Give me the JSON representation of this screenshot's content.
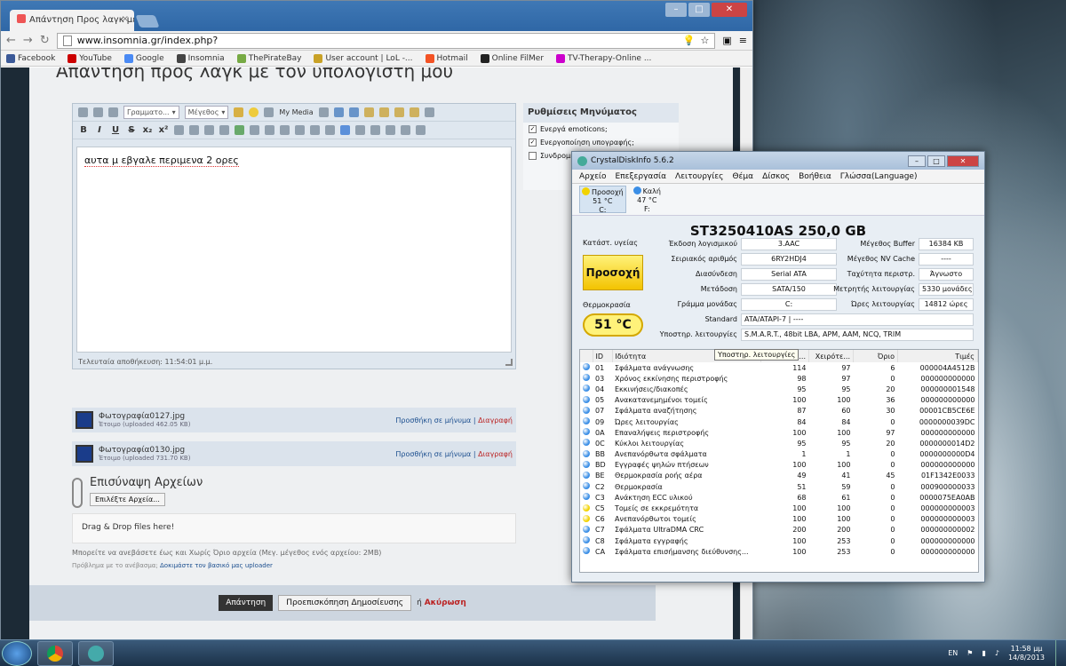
{
  "browser": {
    "tab_title": "Απάντηση Προς λαγκ με...",
    "url": "www.insomnia.gr/index.php?",
    "bookmarks": [
      "Facebook",
      "YouTube",
      "Google",
      "Insomnia",
      "ThePirateBay",
      "User account | LoL -...",
      "Hotmail",
      "Online FilMer",
      "TV-Therapy-Online ..."
    ],
    "bookmark_colors": [
      "#3b5998",
      "#cc0000",
      "#4a8af4",
      "#444444",
      "#7a4",
      "#c9a227",
      "#f35325",
      "#222222",
      "#c0c"
    ]
  },
  "page": {
    "heading": "Απάντηση προς λαγκ με τον υπολογιστή μου",
    "editor": {
      "font_select": "Γραμματο...",
      "size_select": "Μέγεθος",
      "my_media": "My Media",
      "text": "αυτα μ εβγαλε περιμενα 2 ορες",
      "autosave": "Τελευταία αποθήκευση: 11:54:01 μ.μ."
    },
    "sidebar": {
      "title": "Ρυθμίσεις Μηνύματος",
      "options": [
        {
          "label": "Ενεργά emoticons;",
          "checked": "✓"
        },
        {
          "label": "Ενεργοποίηση υπογραφής;",
          "checked": "✓"
        },
        {
          "label": "Συνδρομή",
          "checked": ""
        }
      ]
    },
    "attachments": [
      {
        "name": "Φωτογραφία0127.jpg",
        "status": "Έτοιμο (uploaded 462.05 KB)"
      },
      {
        "name": "Φωτογραφία0130.jpg",
        "status": "Έτοιμο (uploaded 731.70 KB)"
      }
    ],
    "attach_actions": {
      "insert": "Προσθήκη σε μήνυμα",
      "sep": " | ",
      "delete": "Διαγραφή"
    },
    "upload": {
      "title": "Επισύναψη Αρχείων",
      "choose": "Επιλέξτε Αρχεία...",
      "dnd": "Drag & Drop files here!",
      "note": "Μπορείτε να ανεβάσετε έως και Χωρίς Όριο αρχεία (Μεγ. μέγεθος ενός αρχείου: 2MB)",
      "note2_a": "Πρόβλημα με το ανέβασμα;",
      "note2_b": "Δοκιμάστε τον βασικό μας uploader"
    },
    "submit": "Απάντηση",
    "preview": "Προεπισκόπηση Δημοσίευσης",
    "or_text": "ή",
    "cancel": "Ακύρωση"
  },
  "cdi": {
    "title": "CrystalDiskInfo 5.6.2",
    "menu": [
      "Αρχείο",
      "Επεξεργασία",
      "Λειτουργίες",
      "Θέμα",
      "Δίσκος",
      "Βοήθεια",
      "Γλώσσα(Language)"
    ],
    "drives": [
      {
        "status": "Προσοχή",
        "temp": "51 °C",
        "letter": "C:",
        "color": "#f2d300"
      },
      {
        "status": "Καλή",
        "temp": "47 °C",
        "letter": "F:",
        "color": "#3a8ee6"
      }
    ],
    "model": "ST3250410AS  250,0 GB",
    "health_label": "Κατάστ. υγείας",
    "health": "Προσοχή",
    "temp_label": "Θερμοκρασία",
    "temp": "51 °C",
    "fields": {
      "firmware_l": "Έκδοση λογισμικού",
      "firmware": "3.AAC",
      "serial_l": "Σειριακός αριθμός",
      "serial": "6RY2HDJ4",
      "iface_l": "Διασύνδεση",
      "iface": "Serial ATA",
      "transfer_l": "Μετάδοση",
      "transfer": "SATA/150",
      "letter_l": "Γράμμα μονάδας",
      "letter": "C:",
      "standard_l": "Standard",
      "standard": "ATA/ATAPI-7 | ----",
      "features_l": "Υποστηρ. λειτουργίες",
      "features": "S.M.A.R.T., 48bit LBA, APM, AAM, NCQ, TRIM",
      "buffer_l": "Μέγεθος Buffer",
      "buffer": "16384 KB",
      "nvcache_l": "Μέγεθος NV Cache",
      "nvcache": "----",
      "rpm_l": "Ταχύτητα περιστρ.",
      "rpm": "Άγνωστο",
      "count_l": "Μετρητής λειτουργίας",
      "count": "5330 μονάδες",
      "hours_l": "Ώρες λειτουργίας",
      "hours": "14812 ώρες"
    },
    "tooltip": "Υποστηρ. λειτουργίες",
    "columns": [
      "ID",
      "Ιδιότητα",
      "...",
      "Χειρότε...",
      "Όριο",
      "Τιμές"
    ],
    "rows": [
      {
        "id": "01",
        "name": "Σφάλματα ανάγνωσης",
        "cur": "114",
        "worst": "97",
        "thr": "6",
        "raw": "000004A4512B",
        "c": "#3a8ee6"
      },
      {
        "id": "03",
        "name": "Χρόνος εκκίνησης περιστροφής",
        "cur": "98",
        "worst": "97",
        "thr": "0",
        "raw": "000000000000",
        "c": "#3a8ee6"
      },
      {
        "id": "04",
        "name": "Εκκινήσεις/διακοπές",
        "cur": "95",
        "worst": "95",
        "thr": "20",
        "raw": "000000001548",
        "c": "#3a8ee6"
      },
      {
        "id": "05",
        "name": "Ανακατανεμημένοι τομείς",
        "cur": "100",
        "worst": "100",
        "thr": "36",
        "raw": "000000000000",
        "c": "#3a8ee6"
      },
      {
        "id": "07",
        "name": "Σφάλματα αναζήτησης",
        "cur": "87",
        "worst": "60",
        "thr": "30",
        "raw": "00001CB5CE6E",
        "c": "#3a8ee6"
      },
      {
        "id": "09",
        "name": "Ώρες λειτουργίας",
        "cur": "84",
        "worst": "84",
        "thr": "0",
        "raw": "0000000039DC",
        "c": "#3a8ee6"
      },
      {
        "id": "0A",
        "name": "Επαναλήψεις περιστροφής",
        "cur": "100",
        "worst": "100",
        "thr": "97",
        "raw": "000000000000",
        "c": "#3a8ee6"
      },
      {
        "id": "0C",
        "name": "Κύκλοι λειτουργίας",
        "cur": "95",
        "worst": "95",
        "thr": "20",
        "raw": "0000000014D2",
        "c": "#3a8ee6"
      },
      {
        "id": "BB",
        "name": "Ανεπανόρθωτα σφάλματα",
        "cur": "1",
        "worst": "1",
        "thr": "0",
        "raw": "0000000000D4",
        "c": "#3a8ee6"
      },
      {
        "id": "BD",
        "name": "Εγγραφές ψηλών πτήσεων",
        "cur": "100",
        "worst": "100",
        "thr": "0",
        "raw": "000000000000",
        "c": "#3a8ee6"
      },
      {
        "id": "BE",
        "name": "Θερμοκρασία ροής αέρα",
        "cur": "49",
        "worst": "41",
        "thr": "45",
        "raw": "01F1342E0033",
        "c": "#3a8ee6"
      },
      {
        "id": "C2",
        "name": "Θερμοκρασία",
        "cur": "51",
        "worst": "59",
        "thr": "0",
        "raw": "000900000033",
        "c": "#3a8ee6"
      },
      {
        "id": "C3",
        "name": "Ανάκτηση ECC υλικού",
        "cur": "68",
        "worst": "61",
        "thr": "0",
        "raw": "0000075EA0AB",
        "c": "#3a8ee6"
      },
      {
        "id": "C5",
        "name": "Τομείς σε εκκρεμότητα",
        "cur": "100",
        "worst": "100",
        "thr": "0",
        "raw": "000000000003",
        "c": "#f2d300"
      },
      {
        "id": "C6",
        "name": "Ανεπανόρθωτοι τομείς",
        "cur": "100",
        "worst": "100",
        "thr": "0",
        "raw": "000000000003",
        "c": "#f2d300"
      },
      {
        "id": "C7",
        "name": "Σφάλματα UltraDMA CRC",
        "cur": "200",
        "worst": "200",
        "thr": "0",
        "raw": "000000000002",
        "c": "#3a8ee6"
      },
      {
        "id": "C8",
        "name": "Σφάλματα εγγραφής",
        "cur": "100",
        "worst": "253",
        "thr": "0",
        "raw": "000000000000",
        "c": "#3a8ee6"
      },
      {
        "id": "CA",
        "name": "Σφάλματα επισήμανσης διεύθυνσης...",
        "cur": "100",
        "worst": "253",
        "thr": "0",
        "raw": "000000000000",
        "c": "#3a8ee6"
      }
    ]
  },
  "taskbar": {
    "lang": "EN",
    "time": "11:58 μμ",
    "date": "14/8/2013"
  }
}
